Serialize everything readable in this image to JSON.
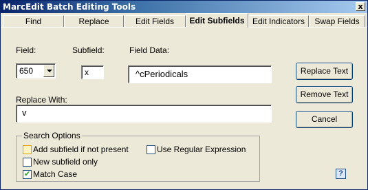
{
  "window": {
    "title": "MarcEdit Batch Editing Tools",
    "close_glyph": "x"
  },
  "tabs": [
    {
      "label": "Find"
    },
    {
      "label": "Replace"
    },
    {
      "label": "Edit Fields"
    },
    {
      "label": "Edit Subfields"
    },
    {
      "label": "Edit Indicators"
    },
    {
      "label": "Swap Fields"
    }
  ],
  "active_tab": "Edit Subfields",
  "form": {
    "field_label": "Field:",
    "field_value": "650",
    "subfield_label": "Subfield:",
    "subfield_value": "x",
    "field_data_label": "Field Data:",
    "field_data_value": "^cPeriodicals",
    "replace_with_label": "Replace With:",
    "replace_with_value": "v"
  },
  "buttons": {
    "replace_text": "Replace Text",
    "remove_text": "Remove Text",
    "cancel": "Cancel"
  },
  "search_options": {
    "legend": "Search Options",
    "add_subfield": {
      "label": "Add subfield if not present",
      "checked": false
    },
    "new_subfield_only": {
      "label": "New subfield only",
      "checked": false
    },
    "match_case": {
      "label": "Match Case",
      "checked": true
    },
    "use_regex": {
      "label": "Use Regular Expression",
      "checked": false
    }
  },
  "help": {
    "glyph": "?"
  },
  "colors": {
    "title_bar": "#0a246a",
    "dialog_bg": "#ece9d8",
    "check_mark": "#21a121"
  }
}
